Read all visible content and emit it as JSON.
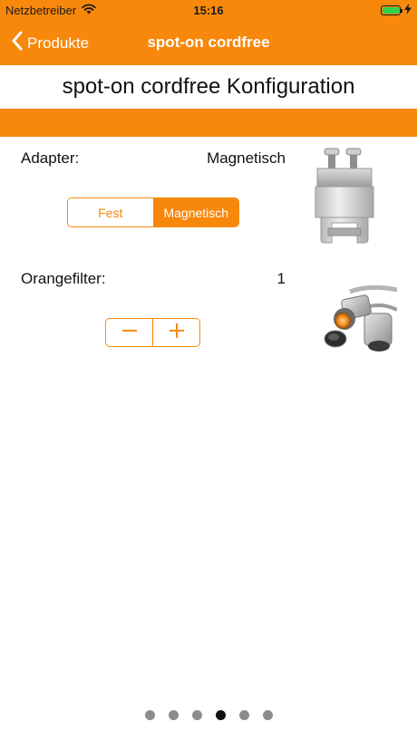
{
  "status_bar": {
    "carrier": "Netzbetreiber",
    "time": "15:16"
  },
  "nav": {
    "back_label": "Produkte",
    "title": "spot-on cordfree"
  },
  "page": {
    "heading": "spot-on cordfree Konfiguration"
  },
  "adapter": {
    "label": "Adapter:",
    "value": "Magnetisch",
    "options": [
      "Fest",
      "Magnetisch"
    ],
    "selected": "Magnetisch"
  },
  "orangefilter": {
    "label": "Orangefilter:",
    "value": "1"
  },
  "pagination": {
    "count": 6,
    "active_index": 3
  },
  "colors": {
    "accent": "#f7880c",
    "dot_inactive": "#8c8c8c",
    "dot_active": "#111111"
  },
  "icons": {
    "back": "chevron-left-icon",
    "wifi": "wifi-icon",
    "battery": "battery-icon",
    "charging": "bolt-icon",
    "minus": "minus-icon",
    "plus": "plus-icon"
  }
}
